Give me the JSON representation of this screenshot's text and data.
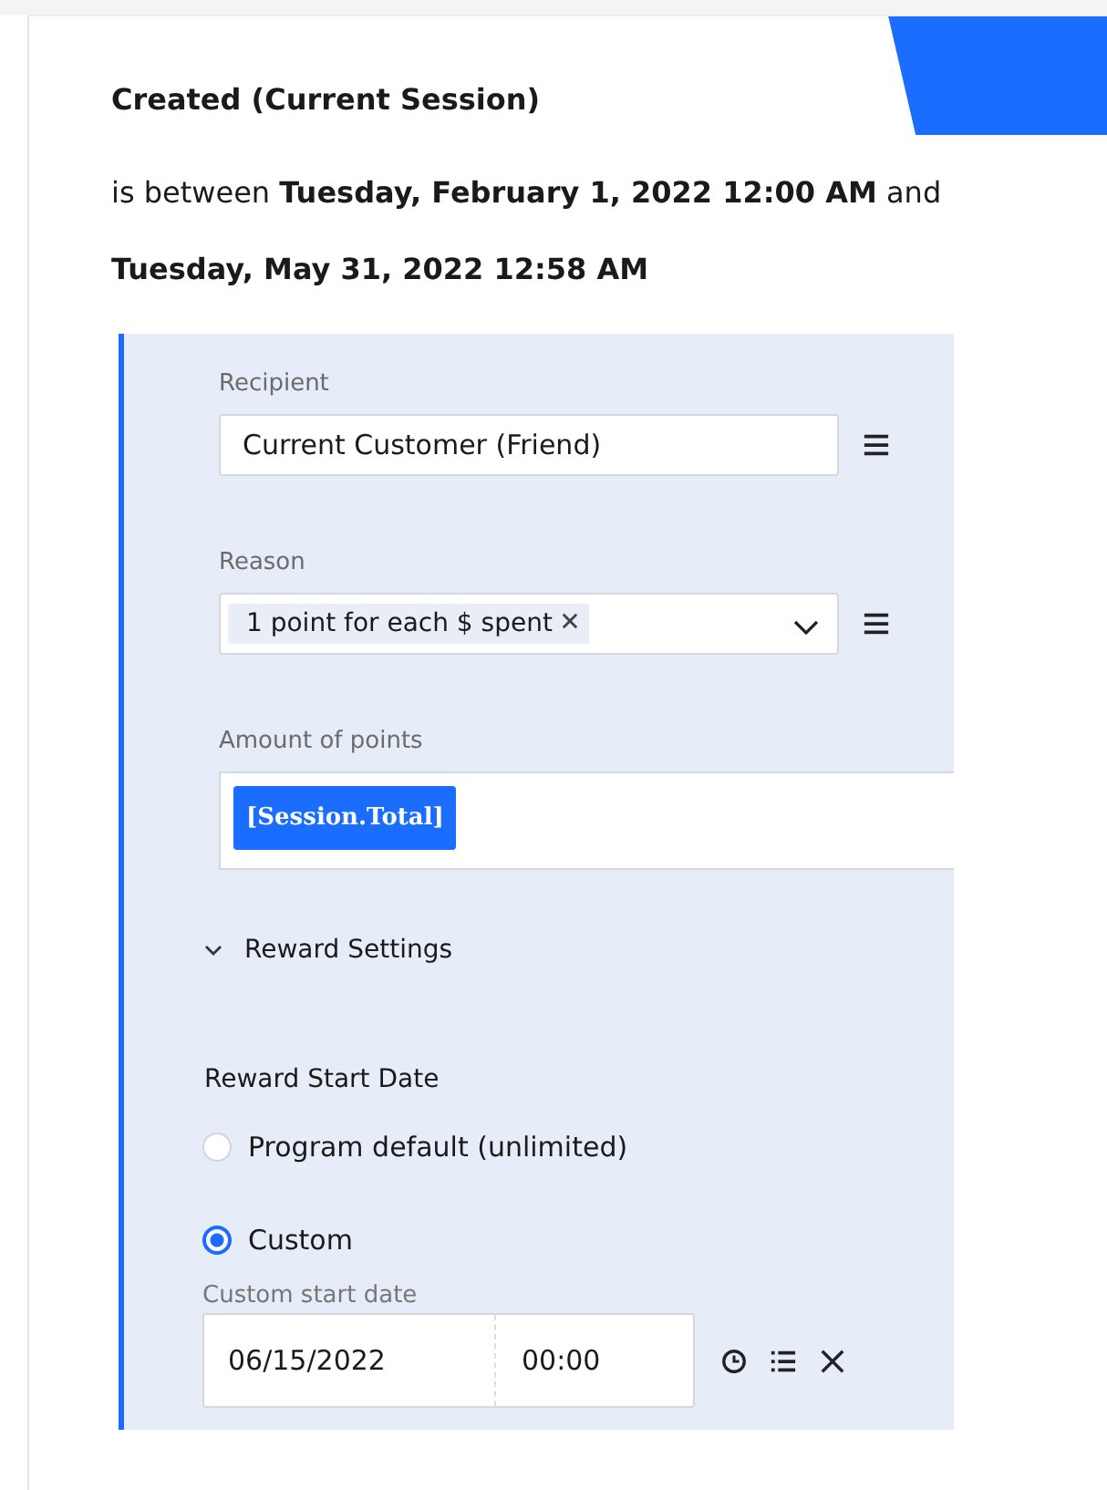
{
  "condition": {
    "field": "Created (Current Session)",
    "text": "is between **Tuesday, February 1, 2022 12:00 AM** and **Tuesday, May 31, 2022 12:58 AM**"
  },
  "recipient": {
    "label": "Recipient",
    "value": "Current Customer (Friend)"
  },
  "reason": {
    "label": "Reason",
    "tags": [
      "1 point for each $ spent"
    ]
  },
  "amount": {
    "label": "Amount of points",
    "tokens": [
      "[Session.Total]"
    ]
  },
  "reward_settings": {
    "label": "Reward Settings",
    "expanded": true
  },
  "start_date": {
    "label": "Reward Start Date",
    "options": [
      {
        "label": "Program default (unlimited)",
        "selected": false
      },
      {
        "label": "Custom",
        "selected": true
      }
    ],
    "custom": {
      "label": "Custom start date",
      "date": "06/15/2022",
      "time": "00:00"
    }
  }
}
